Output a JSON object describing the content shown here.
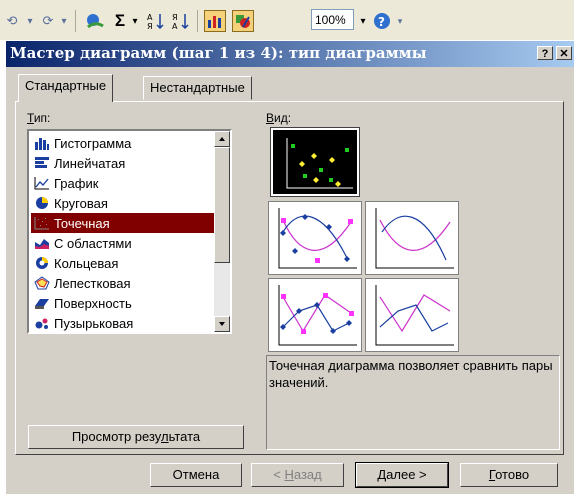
{
  "toolbar": {
    "zoom_value": "100%",
    "icons": [
      "undo-arrow-icon",
      "redo-arrow-icon",
      "hyperlink-icon",
      "autosum-icon",
      "sort-ascending-icon",
      "sort-descending-icon",
      "chart-wizard-icon",
      "drawing-icon",
      "help-icon"
    ]
  },
  "dialog": {
    "title": "Мастер диаграмм (шаг 1 из 4): тип диаграммы",
    "help_button": "?",
    "close_button": "✕",
    "tabs": [
      "Стандартные",
      "Нестандартные"
    ],
    "type_label": "Тип:",
    "type_label_ul": "Т",
    "view_label": "Вид:",
    "view_label_ul": "В",
    "chart_types": [
      {
        "label": "Гистограмма",
        "icon": "histogram-icon"
      },
      {
        "label": "Линейчатая",
        "icon": "bar-chart-icon"
      },
      {
        "label": "График",
        "icon": "line-chart-icon"
      },
      {
        "label": "Круговая",
        "icon": "pie-chart-icon"
      },
      {
        "label": "Точечная",
        "icon": "scatter-chart-icon"
      },
      {
        "label": "С областями",
        "icon": "area-chart-icon"
      },
      {
        "label": "Кольцевая",
        "icon": "donut-chart-icon"
      },
      {
        "label": "Лепестковая",
        "icon": "radar-chart-icon"
      },
      {
        "label": "Поверхность",
        "icon": "surface-chart-icon"
      },
      {
        "label": "Пузырьковая",
        "icon": "bubble-chart-icon"
      }
    ],
    "selected_type": "Точечная",
    "description": "Точечная диаграмма позволяет сравнить пары значений.",
    "preview_button": "Просмотр результата",
    "buttons": {
      "cancel": "Отмена",
      "back": "< Назад",
      "next": "Далее >",
      "finish": "Готово"
    },
    "colors": {
      "title_gradient_start": "#0a246a",
      "selection": "#800000",
      "face": "#d4d0c8"
    }
  }
}
